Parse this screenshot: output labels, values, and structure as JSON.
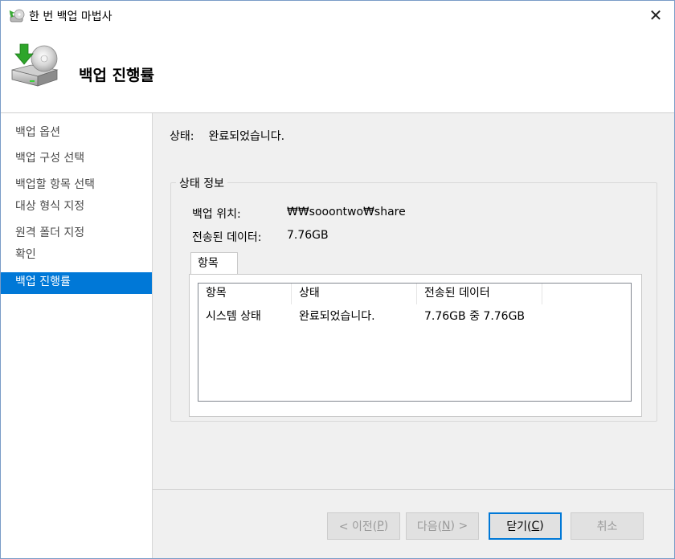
{
  "window": {
    "title": "한 번 백업 마법사",
    "close_glyph": "✕"
  },
  "header": {
    "title": "백업 진행률"
  },
  "sidebar": {
    "items": [
      {
        "label": "백업 옵션",
        "active": false
      },
      {
        "label": "백업 구성 선택",
        "active": false
      },
      {
        "label": "백업할 항목 선택",
        "active": false
      },
      {
        "label": "대상 형식 지정",
        "active": false
      },
      {
        "label": "원격 폴더 지정",
        "active": false
      },
      {
        "label": "확인",
        "active": false
      },
      {
        "label": "백업 진행률",
        "active": true
      }
    ]
  },
  "main": {
    "status_label": "상태:",
    "status_value": "완료되었습니다.",
    "group": {
      "legend": "상태 정보",
      "location_label": "백업 위치:",
      "location_value": "₩₩sooontwo₩share",
      "transferred_label": "전송된 데이터:",
      "transferred_value": "7.76GB"
    },
    "tab_label": "항목",
    "list": {
      "columns": [
        "항목",
        "상태",
        "전송된 데이터"
      ],
      "rows": [
        [
          "시스템 상태",
          "완료되었습니다.",
          "7.76GB 중 7.76GB"
        ]
      ]
    }
  },
  "footer": {
    "prev": {
      "text": "< 이전(",
      "key": "P",
      "close": ")"
    },
    "next": {
      "text": "다음(",
      "key": "N",
      "close": ") >"
    },
    "close": {
      "text": "닫기(",
      "key": "C",
      "close": ")"
    },
    "cancel": {
      "text": "취소"
    }
  },
  "colors": {
    "accent": "#0078d7",
    "panel_bg": "#f0f0f0"
  }
}
